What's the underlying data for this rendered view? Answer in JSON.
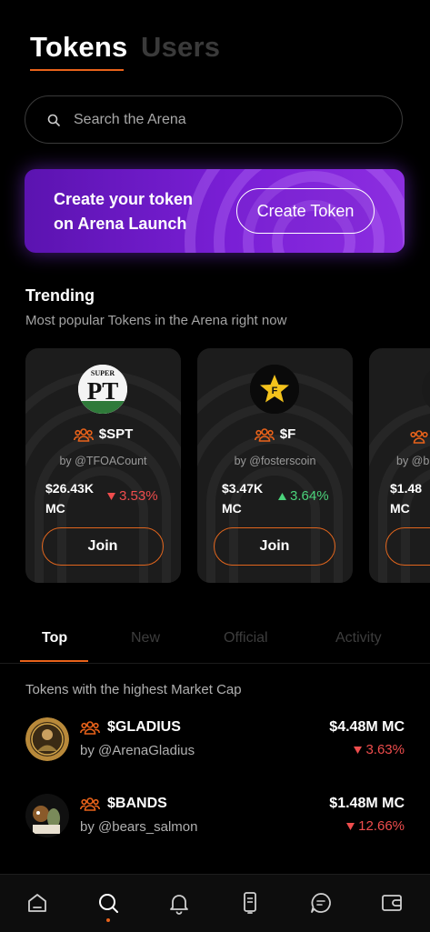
{
  "header": {
    "tabs": [
      "Tokens",
      "Users"
    ],
    "active": "Tokens"
  },
  "search": {
    "placeholder": "Search the Arena"
  },
  "banner": {
    "line1": "Create your token",
    "line2": "on Arena Launch",
    "button": "Create Token"
  },
  "trending": {
    "title": "Trending",
    "subtitle": "Most popular Tokens in the Arena right now",
    "cards": [
      {
        "ticker": "$SPT",
        "by": "by @TFOACount",
        "mc_value": "$26.43K",
        "mc_label": "MC",
        "change": "3.53%",
        "direction": "down",
        "join": "Join",
        "logo_text_top": "SUPER",
        "logo_text_main": "PT"
      },
      {
        "ticker": "$F",
        "by": "by @fosterscoin",
        "mc_value": "$3.47K",
        "mc_label": "MC",
        "change": "3.64%",
        "direction": "up",
        "join": "Join",
        "logo_text_main": "F"
      },
      {
        "ticker": "",
        "by": "by @b",
        "mc_value": "$1.48",
        "mc_label": "MC",
        "change": "",
        "direction": "",
        "join": ""
      }
    ]
  },
  "list_tabs": [
    "Top",
    "New",
    "Official",
    "Activity"
  ],
  "list_tabs_active": "Top",
  "list": {
    "subtitle": "Tokens with the highest Market Cap",
    "rows": [
      {
        "ticker": "$GLADIUS",
        "by": "by @ArenaGladius",
        "mc": "$4.48M MC",
        "change": "3.63%",
        "direction": "down"
      },
      {
        "ticker": "$BANDS",
        "by": "by @bears_salmon",
        "mc": "$1.48M MC",
        "change": "12.66%",
        "direction": "down"
      }
    ]
  },
  "nav": {
    "items": [
      "home-icon",
      "search-icon",
      "bell-icon",
      "phone-icon",
      "chat-icon",
      "wallet-icon"
    ],
    "active": "search-icon"
  },
  "colors": {
    "accent": "#e8621a",
    "banner_purple": "#7a1fd6",
    "down": "#ef4d4d",
    "up": "#4bd37b"
  }
}
